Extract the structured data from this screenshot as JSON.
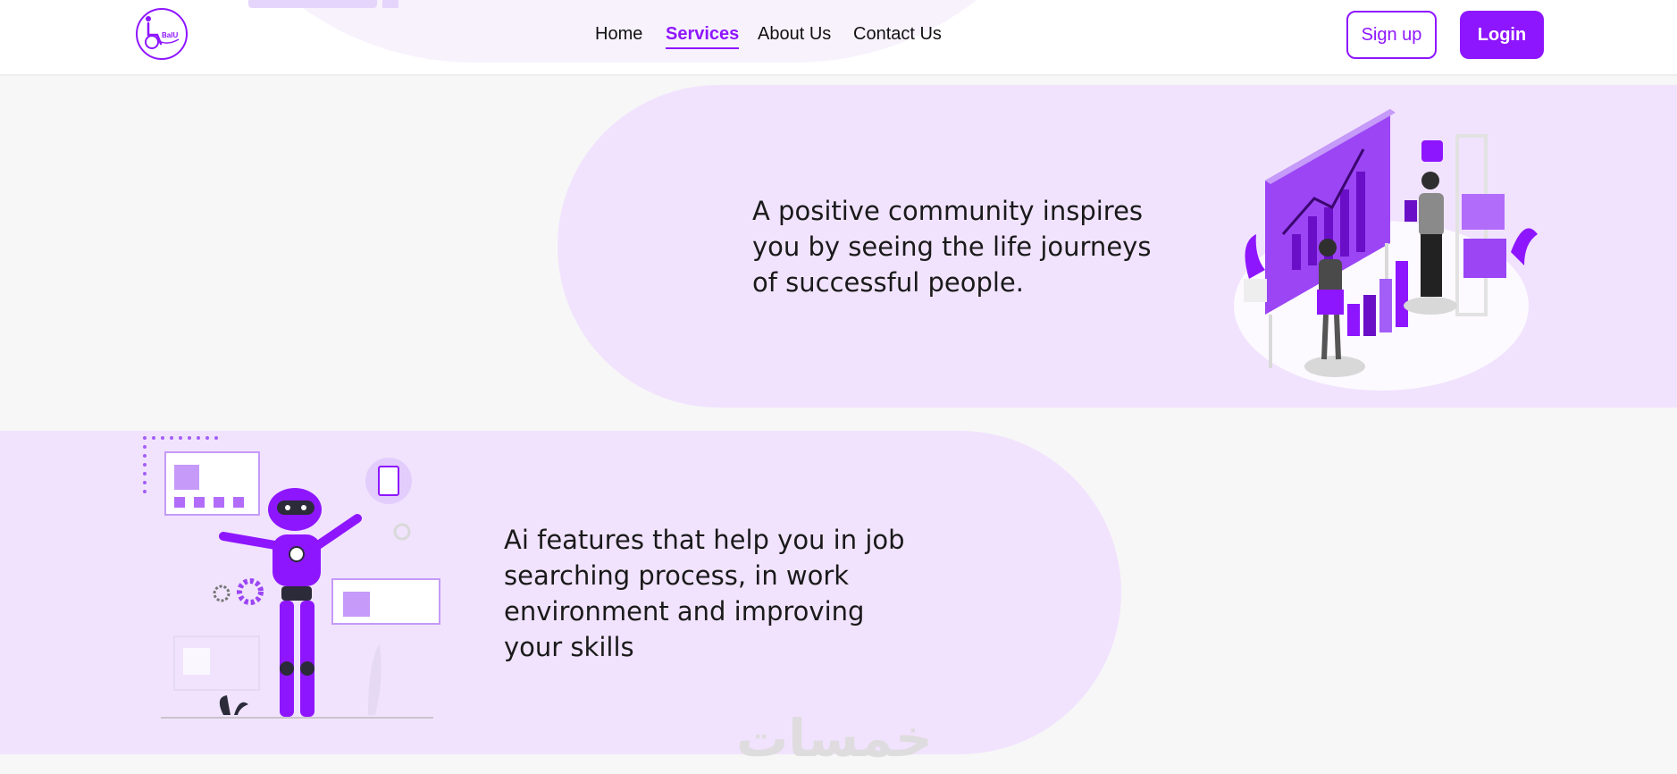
{
  "header": {
    "logo_icon": "wheelchair-logo-icon",
    "logo_text": "BaIU",
    "nav": [
      {
        "label": "Home",
        "active": false
      },
      {
        "label": "Services",
        "active": true
      },
      {
        "label": "About Us",
        "active": false
      },
      {
        "label": "Contact Us",
        "active": false
      }
    ],
    "signup_label": "Sign up",
    "login_label": "Login"
  },
  "features": [
    {
      "text": "A positive community inspires you by seeing the life journeys of successful people.",
      "illustration": "business-presentation-illustration"
    },
    {
      "text": "Ai features that help you in job searching process, in work environment and improving your skills",
      "illustration": "robot-illustration"
    }
  ],
  "watermark": "خمسات",
  "colors": {
    "accent": "#8e16ff",
    "band": "#f1e3fd",
    "background": "#f7f7f7"
  }
}
